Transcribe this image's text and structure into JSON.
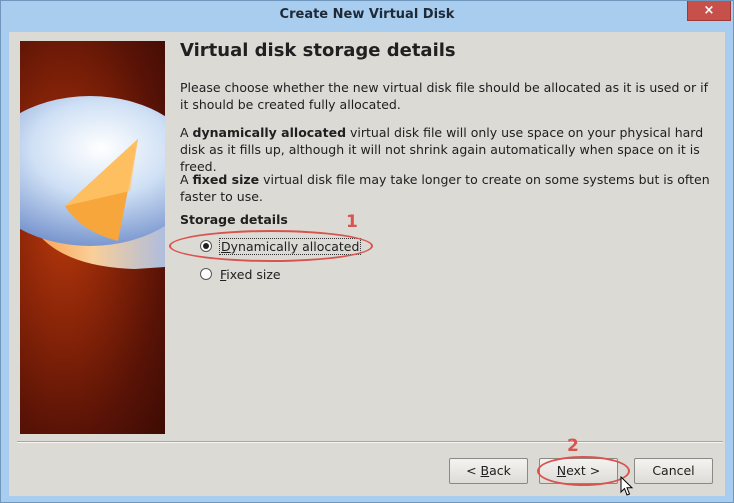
{
  "window": {
    "title": "Create New Virtual Disk",
    "close_label": "×"
  },
  "page": {
    "heading": "Virtual disk storage details",
    "intro": "Please choose whether the new virtual disk file should be allocated as it is used or if it should be created fully allocated.",
    "dynamic_prefix": "A ",
    "dynamic_bold": "dynamically allocated",
    "dynamic_rest": " virtual disk file will only use space on your physical hard disk as it fills up, although it will not shrink again automatically when space on it is freed.",
    "fixed_prefix": "A ",
    "fixed_bold": "fixed size",
    "fixed_rest": " virtual disk file may take longer to create on some systems but is often faster to use."
  },
  "storage": {
    "group_label": "Storage details",
    "options": [
      {
        "mnemonic": "D",
        "rest": "ynamically allocated",
        "checked": true
      },
      {
        "mnemonic": "F",
        "rest": "ixed size",
        "checked": false
      }
    ]
  },
  "buttons": {
    "back_prefix": "< ",
    "back_mnemonic": "B",
    "back_rest": "ack",
    "next_mnemonic": "N",
    "next_rest": "ext >",
    "cancel": "Cancel"
  },
  "annotations": {
    "step1": "1",
    "step2": "2",
    "color": "#d9534f"
  }
}
